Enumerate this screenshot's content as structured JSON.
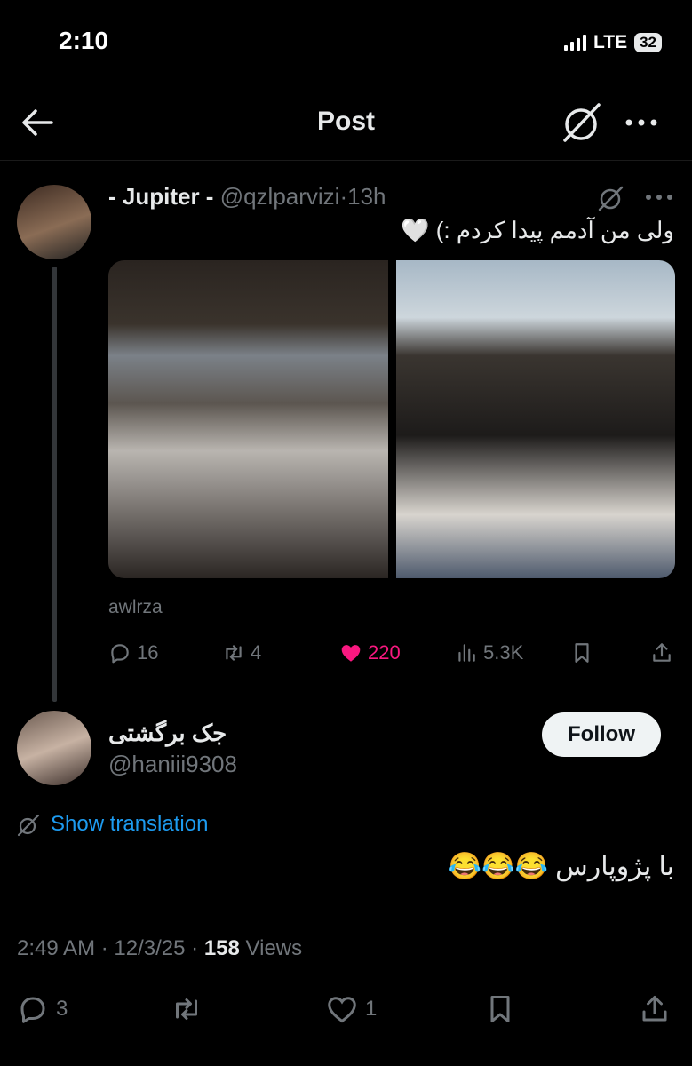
{
  "status_bar": {
    "time": "2:10",
    "network": "LTE",
    "battery": "32"
  },
  "header": {
    "title": "Post"
  },
  "parent_post": {
    "display_name": "- Jupiter -",
    "handle": "@qzlparvizi",
    "time": "13h",
    "text": "ولی من آدمم پیدا کردم :) 🤍",
    "media_credit": "awlrza",
    "stats": {
      "replies": "16",
      "reposts": "4",
      "likes": "220",
      "views": "5.3K"
    }
  },
  "reply_post": {
    "display_name": "جک برگشتی",
    "handle": "@haniii9308",
    "follow_label": "Follow",
    "translate_label": "Show translation",
    "text": "با پژوپارس 😂😂😂",
    "time": "2:49 AM",
    "date": "12/3/25",
    "views_count": "158",
    "views_label": "Views",
    "stats": {
      "replies": "3",
      "likes": "1"
    }
  },
  "colors": {
    "like_active": "#f91880",
    "link": "#1d9bf0",
    "muted": "#71767b"
  },
  "icons": [
    "back-arrow-icon",
    "grok-icon",
    "more-icon",
    "reply-icon",
    "repost-icon",
    "heart-icon",
    "views-icon",
    "bookmark-icon",
    "share-icon",
    "translate-icon"
  ]
}
